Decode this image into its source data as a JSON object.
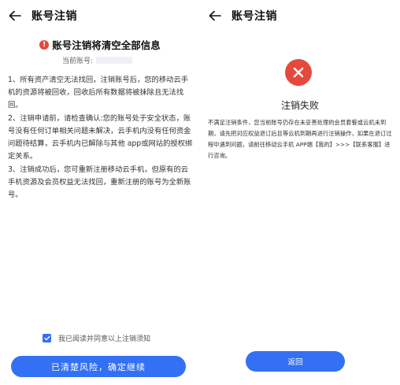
{
  "left": {
    "header": {
      "title": "账号注销"
    },
    "notice": {
      "icon_text": "!",
      "title": "账号注销将清空全部信息"
    },
    "account": {
      "label": "当前账号:"
    },
    "rules": [
      "1、所有资产清空无法找回，注销账号后，您的移动云手机的资源将被回收，回收后所有数据将被抹除且无法找回。",
      "2、注销申请前，请检查确认:您的账号处于安全状态，账号没有任何订单相关问题未解决，云手机内没有任何资金问题待结算，云手机内已解除与其他 app或网站的授权绑定关系。",
      "3、注销成功后，您可重新注册移动云手机，但原有的云手机资源及会员权益无法找回，重新注册的账号为全新账号。"
    ],
    "agree": {
      "label": "我已阅读并同意以上注销须知",
      "checked": true
    },
    "confirm_button": "已清楚风险，确定继续"
  },
  "right": {
    "header": {
      "title": "账号注销"
    },
    "result": {
      "title": "注销失败",
      "description": "不满足注销条件，您当前账号仍存在未妥善处理的会员套餐或云机未到期，请先把对应权益退订后且等云机到期再进行注销操作，如果在退订过程中遇到问题，请前往移动云手机 APP端【我的】>>>【联系客服】进行咨询。"
    },
    "return_button": "返回"
  },
  "colors": {
    "primary": "#3370f4",
    "danger": "#e5493d"
  },
  "icons": [
    "back-arrow-icon",
    "warning-icon",
    "checkbox-checked-icon",
    "fail-x-icon"
  ]
}
